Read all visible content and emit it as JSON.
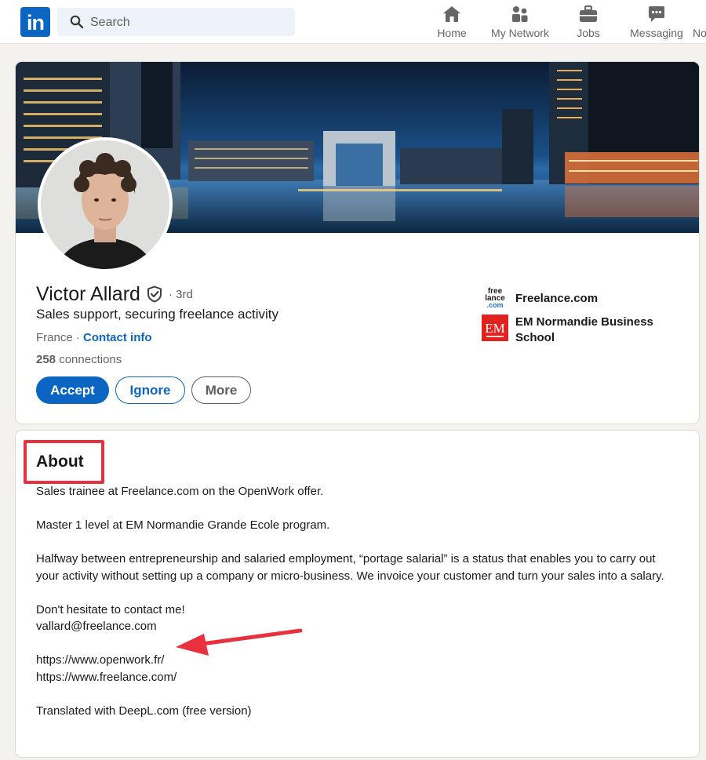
{
  "nav": {
    "logo_text": "in",
    "search_placeholder": "Search",
    "items": [
      {
        "label": "Home",
        "icon": "home-icon"
      },
      {
        "label": "My Network",
        "icon": "network-icon"
      },
      {
        "label": "Jobs",
        "icon": "briefcase-icon"
      },
      {
        "label": "Messaging",
        "icon": "messaging-icon"
      },
      {
        "label": "No",
        "icon": "notifications-icon"
      }
    ]
  },
  "profile": {
    "name": "Victor Allard",
    "degree": "· 3rd",
    "headline": "Sales support, securing freelance activity",
    "location": "France ·",
    "contact_info": "Contact info",
    "connections_count": "258",
    "connections_label": "connections",
    "buttons": {
      "accept": "Accept",
      "ignore": "Ignore",
      "more": "More"
    },
    "organizations": [
      {
        "name": "Freelance.com",
        "logo_text": "free lance .com"
      },
      {
        "name": "EM Normandie Business School",
        "logo_text": "EM"
      }
    ]
  },
  "about": {
    "title": "About",
    "paragraphs": [
      [
        "Sales trainee at Freelance.com on the OpenWork offer."
      ],
      [
        "Master 1 level at EM Normandie Grande Ecole program."
      ],
      [
        "Halfway between entrepreneurship and salaried employment, “portage salarial” is a status that enables you to carry out your activity without setting up a company or micro-business. We invoice your customer and turn your sales into a salary."
      ],
      [
        "Don't hesitate to contact me!",
        "vallard@freelance.com"
      ],
      [
        "https://www.openwork.fr/",
        "https://www.freelance.com/"
      ],
      [
        "Translated with DeepL.com (free version)"
      ]
    ]
  },
  "colors": {
    "brand": "#0a66c2",
    "annotation": "#e8303e",
    "background": "#f4f2ee"
  }
}
